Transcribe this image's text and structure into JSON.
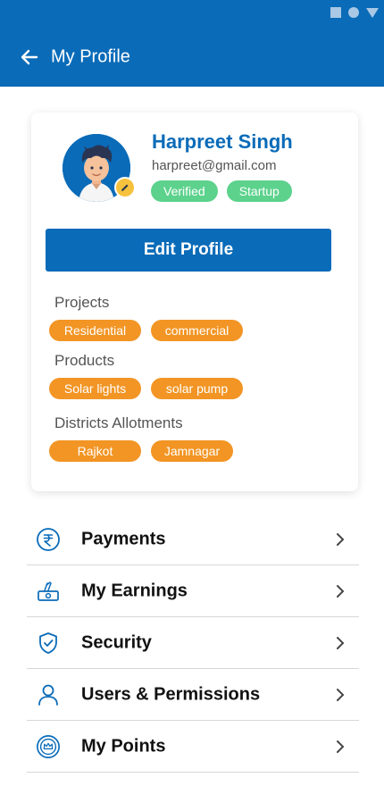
{
  "app_bar": {
    "title": "My Profile"
  },
  "profile": {
    "name": "Harpreet Singh",
    "email": "harpreet@gmail.com",
    "badges": [
      "Verified",
      "Startup"
    ],
    "edit_button": "Edit Profile"
  },
  "sections": [
    {
      "label": "Projects",
      "chips": [
        "Residential",
        "commercial"
      ]
    },
    {
      "label": "Products",
      "chips": [
        "Solar lights",
        "solar pump"
      ]
    },
    {
      "label": "Districts Allotments",
      "chips": [
        "Rajkot",
        "Jamnagar"
      ]
    }
  ],
  "menu": [
    {
      "label": "Payments",
      "icon": "rupee-icon"
    },
    {
      "label": "My Earnings",
      "icon": "earnings-icon"
    },
    {
      "label": "Security",
      "icon": "shield-icon"
    },
    {
      "label": "Users & Permissions",
      "icon": "user-icon"
    },
    {
      "label": "My Points",
      "icon": "points-icon"
    }
  ],
  "colors": {
    "primary": "#0a6bb8",
    "badge_green": "#5cd28c",
    "chip_orange": "#f29524",
    "accent_yellow": "#f6c23e"
  }
}
